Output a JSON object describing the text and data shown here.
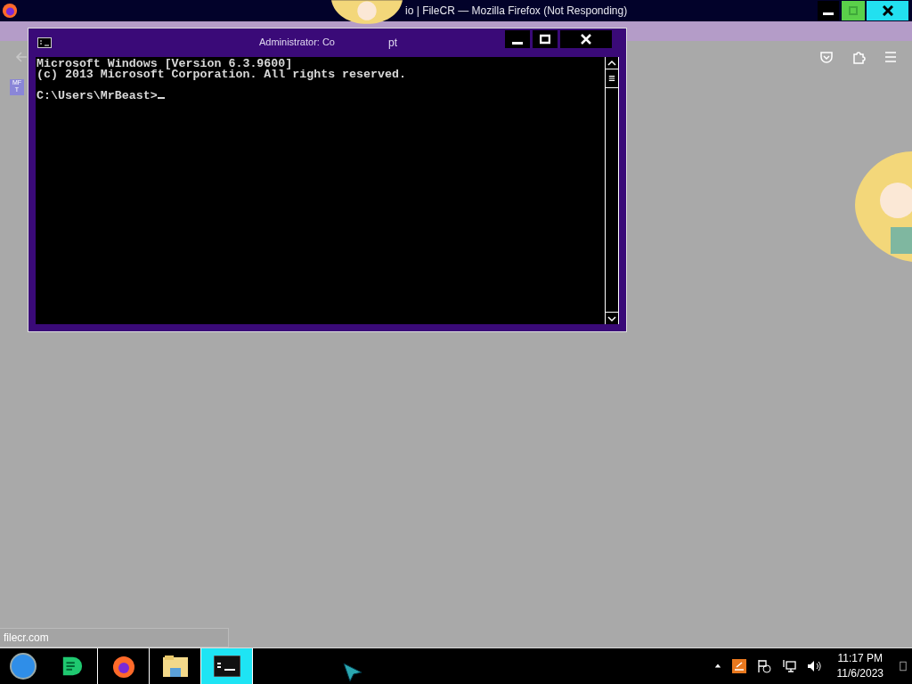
{
  "browser": {
    "title": "io | FileCR — Mozilla Firefox (Not Responding)",
    "sidebar_icon_text": [
      "MF",
      "T"
    ],
    "status_link": "filecr.com"
  },
  "console": {
    "title_parts": [
      "Administrator: Co",
      "pt"
    ],
    "lines": [
      "Microsoft Windows [Version 6.3.9600]",
      "(c) 2013 Microsoft Corporation. All rights reserved."
    ],
    "prompt": "C:\\Users\\MrBeast>"
  },
  "taskbar": {
    "apps": [
      {
        "kind": "start",
        "selected": false
      },
      {
        "kind": "chat",
        "selected": false
      },
      {
        "kind": "firefox",
        "selected": false
      },
      {
        "kind": "folder",
        "selected": false
      },
      {
        "kind": "console",
        "selected": true
      }
    ],
    "clock": {
      "time": "11:17 PM",
      "date": "11/6/2023"
    }
  }
}
